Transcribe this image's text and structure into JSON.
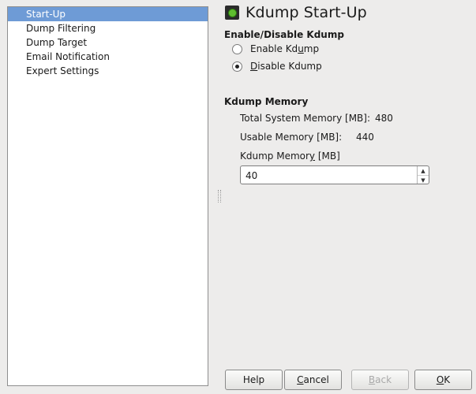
{
  "sidebar": {
    "items": [
      {
        "label": "Start-Up",
        "selected": true
      },
      {
        "label": "Dump Filtering",
        "selected": false
      },
      {
        "label": "Dump Target",
        "selected": false
      },
      {
        "label": "Email Notification",
        "selected": false
      },
      {
        "label": "Expert Settings",
        "selected": false
      }
    ]
  },
  "header": {
    "title": "Kdump Start-Up",
    "icon": "kdump-app-icon"
  },
  "enable_section": {
    "heading": "Enable/Disable Kdump",
    "options": [
      {
        "pre": "Enable Kd",
        "mnemonic": "u",
        "post": "mp",
        "checked": false
      },
      {
        "pre": "",
        "mnemonic": "D",
        "post": "isable Kdump",
        "checked": true
      }
    ]
  },
  "memory_section": {
    "heading": "Kdump Memory",
    "total_label": "Total System Memory [MB]:",
    "total_value": "480",
    "usable_label": "Usable Memory [MB]:",
    "usable_value": "440",
    "kdump_label_pre": "Kdump Memor",
    "kdump_label_mnemonic": "y",
    "kdump_label_post": " [MB]",
    "kdump_value": "40"
  },
  "buttons": {
    "help": "Help",
    "cancel_mnemonic": "C",
    "cancel_rest": "ancel",
    "back_mnemonic": "B",
    "back_rest": "ack",
    "ok_mnemonic": "O",
    "ok_rest": "K"
  },
  "colors": {
    "selection": "#6e9bd6",
    "background": "#edeceb"
  }
}
